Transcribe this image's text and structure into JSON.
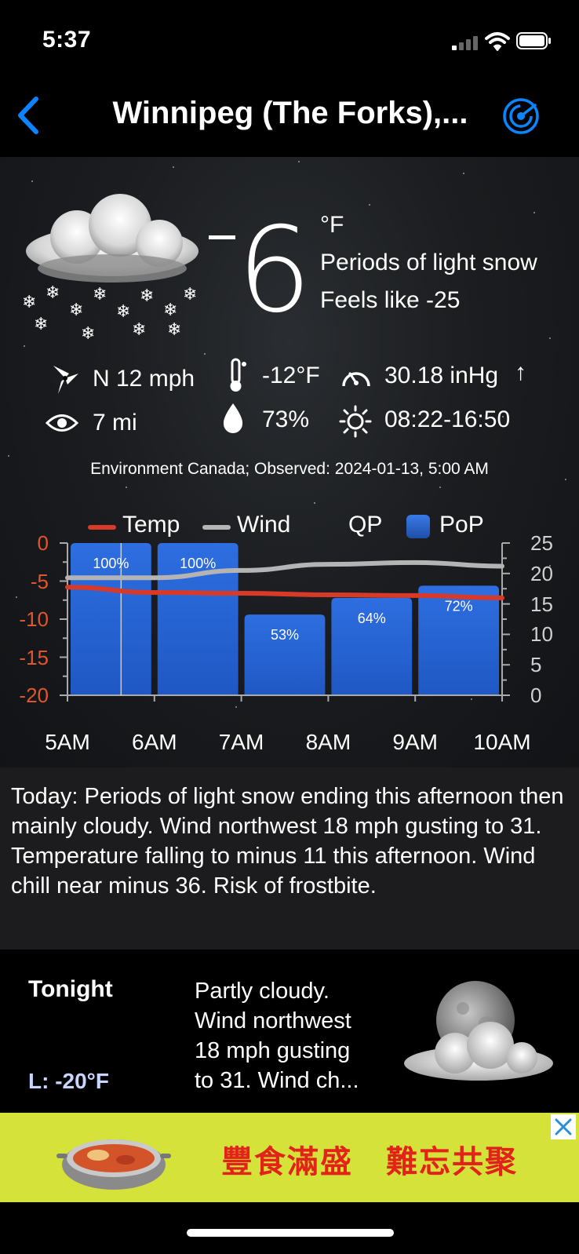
{
  "status_bar": {
    "time": "5:37"
  },
  "nav": {
    "title": "Winnipeg (The Forks),..."
  },
  "current": {
    "temperature": "6",
    "unit": "°F",
    "condition": "Periods of light snow",
    "feels_like": "Feels like -25",
    "wind": "N 12 mph",
    "dew_point": "-12°F",
    "pressure": "30.18 inHg",
    "pressure_trend": "↑",
    "visibility": "7 mi",
    "humidity": "73%",
    "sun": "08:22-16:50",
    "source": "Environment Canada; Observed: 2024-01-13, 5:00 AM"
  },
  "colors": {
    "temp_line": "#d83a2a",
    "wind_line": "#b4b4b4",
    "pop_bar": "#2f6fd6",
    "accent": "#0a84ff"
  },
  "chart_data": {
    "type": "bar",
    "legend": [
      "Temp",
      "Wind",
      "QP",
      "PoP"
    ],
    "categories": [
      "5AM",
      "6AM",
      "7AM",
      "8AM",
      "9AM",
      "10AM"
    ],
    "left_axis": {
      "ticks": [
        "0",
        "-5",
        "-10",
        "-15",
        "-20"
      ],
      "range": [
        -20,
        0
      ]
    },
    "right_axis": {
      "ticks": [
        "25",
        "20",
        "15",
        "10",
        "5",
        "0"
      ],
      "range": [
        0,
        25
      ]
    },
    "series": [
      {
        "name": "PoP",
        "type": "bar",
        "values": [
          100,
          100,
          53,
          64,
          72
        ],
        "labels": [
          "100%",
          "100%",
          "53%",
          "64%",
          "72%"
        ]
      },
      {
        "name": "Temp",
        "type": "line",
        "x": [
          5,
          6,
          7,
          8,
          9,
          10
        ],
        "values": [
          -5.8,
          -6.5,
          -6.6,
          -6.8,
          -6.9,
          -7.2
        ]
      },
      {
        "name": "Wind",
        "type": "line",
        "x": [
          5,
          6,
          7,
          8,
          9,
          10
        ],
        "values": [
          19.3,
          19.3,
          20.5,
          21.5,
          21.8,
          21.2
        ]
      }
    ]
  },
  "today": {
    "text": "Today:  Periods of light snow ending this afternoon then mainly cloudy. Wind northwest 18 mph gusting to 31. Temperature falling to minus 11 this afternoon. Wind chill near minus 36. Risk of frostbite."
  },
  "tonight": {
    "title": "Tonight",
    "low": "L: -20°F",
    "text_lines": [
      "Partly cloudy.",
      "Wind northwest",
      "18 mph gusting",
      "to 31. Wind ch..."
    ]
  },
  "ad": {
    "text": "豐食滿盛　難忘共聚"
  }
}
